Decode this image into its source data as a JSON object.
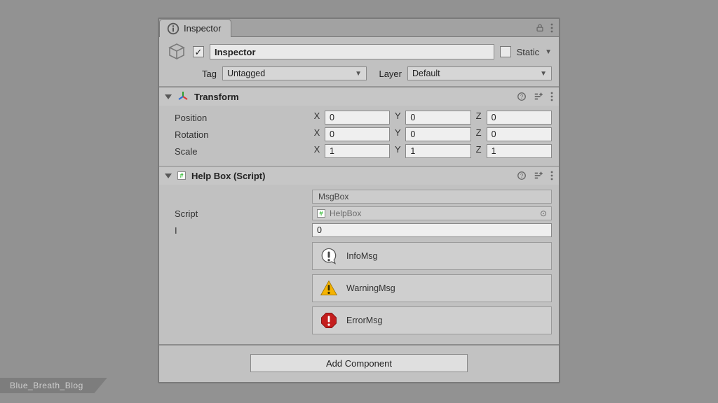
{
  "tab": {
    "title": "Inspector"
  },
  "header": {
    "enabled_check": "✓",
    "name_value": "Inspector",
    "static_label": "Static",
    "tag_label": "Tag",
    "tag_value": "Untagged",
    "layer_label": "Layer",
    "layer_value": "Default"
  },
  "transform": {
    "title": "Transform",
    "position": {
      "label": "Position",
      "x": "0",
      "y": "0",
      "z": "0"
    },
    "rotation": {
      "label": "Rotation",
      "x": "0",
      "y": "0",
      "z": "0"
    },
    "scale": {
      "label": "Scale",
      "x": "1",
      "y": "1",
      "z": "1"
    }
  },
  "helpbox": {
    "title": "Help Box (Script)",
    "header_text": "MsgBox",
    "script_label": "Script",
    "script_value": "HelpBox",
    "i_label": "I",
    "i_value": "0",
    "items": [
      {
        "kind": "info",
        "text": "InfoMsg"
      },
      {
        "kind": "warning",
        "text": "WarningMsg"
      },
      {
        "kind": "error",
        "text": "ErrorMsg"
      }
    ]
  },
  "add_component_label": "Add Component",
  "watermark": "Blue_Breath_Blog",
  "colors": {
    "panel": "#c1c1c1",
    "border": "#7a7a7a",
    "field": "#e9e9e9",
    "warning": "#f5b301",
    "error": "#c41e1e"
  }
}
